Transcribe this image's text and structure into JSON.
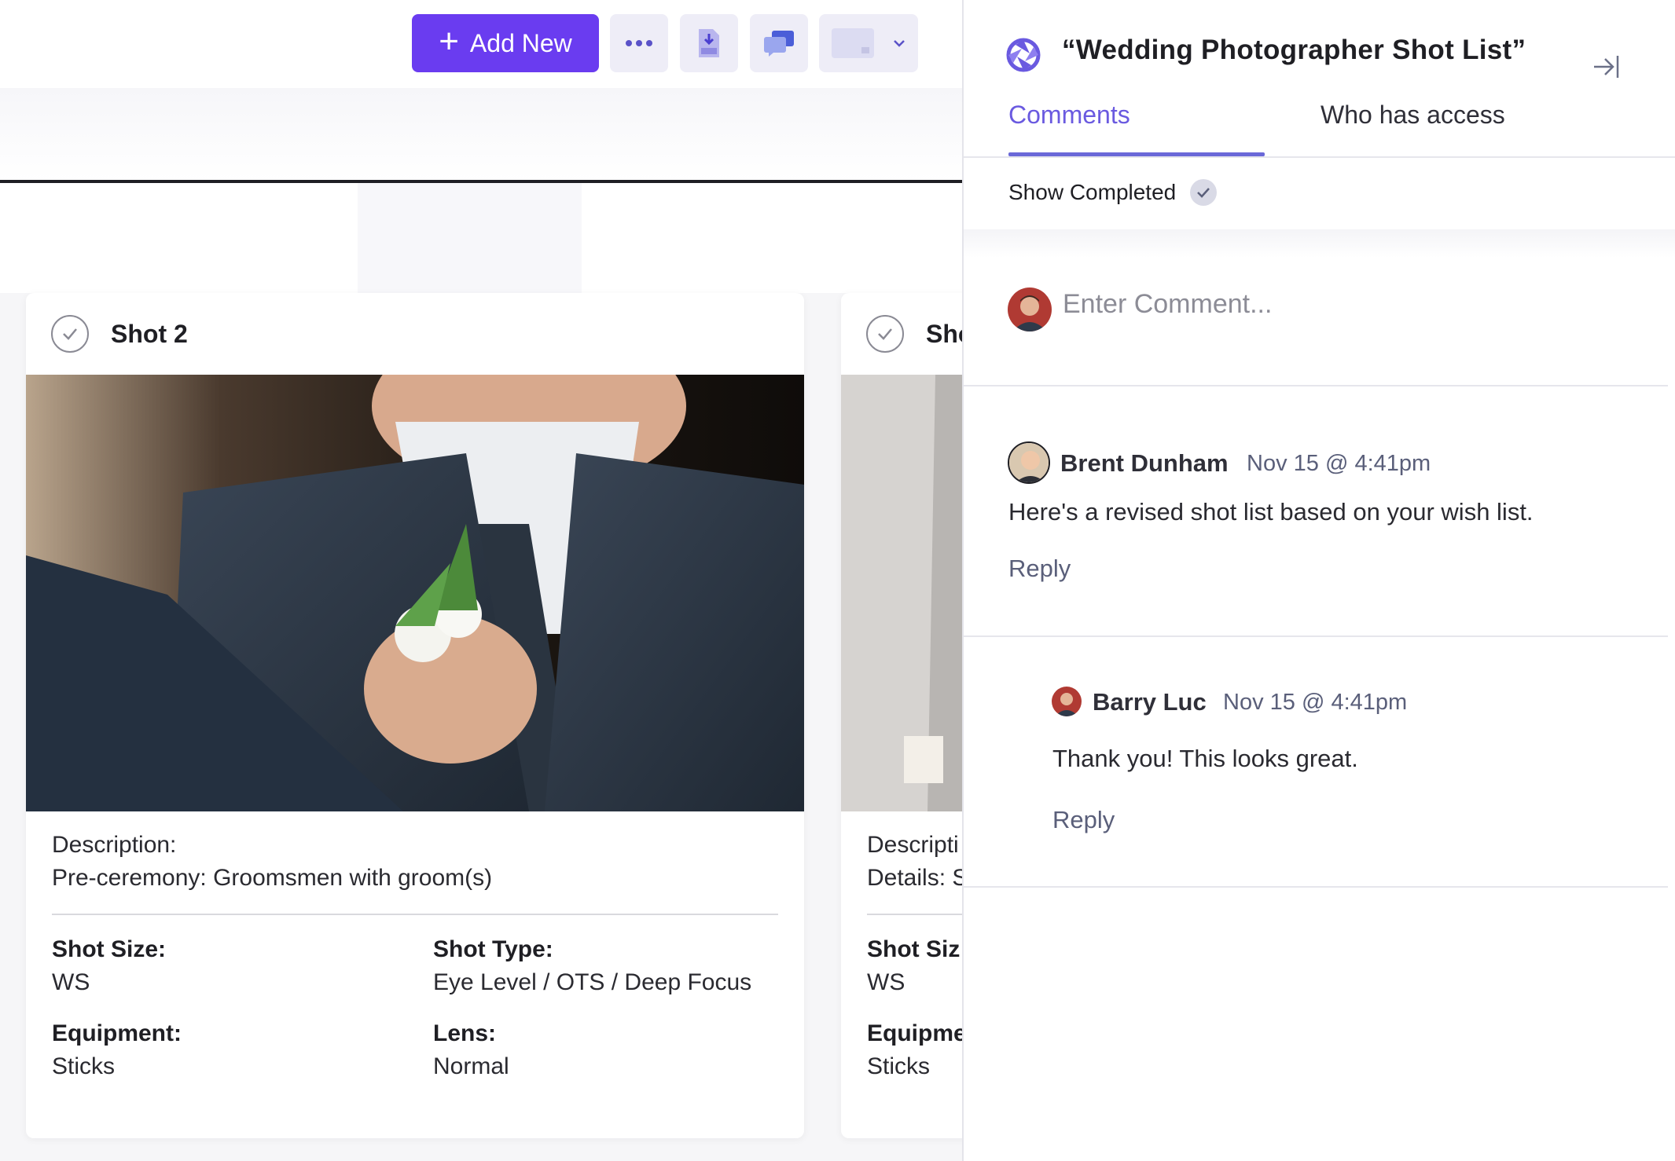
{
  "toolbar": {
    "add_new_label": "Add New",
    "more_icon": "ellipsis-icon",
    "pdf_icon": "pdf-download-icon",
    "chat_icon": "comments-icon",
    "view_icon": "view-toggle-icon",
    "accent": "#6a3cf0"
  },
  "cards": [
    {
      "title": "Shot  2",
      "description_label": "Description:",
      "description_value": "Pre-ceremony: Groomsmen with groom(s)",
      "shot_size_label": "Shot Size:",
      "shot_size_value": "WS",
      "shot_type_label": "Shot Type:",
      "shot_type_value": "Eye Level / OTS / Deep Focus",
      "equipment_label": "Equipment:",
      "equipment_value": "Sticks",
      "lens_label": "Lens:",
      "lens_value": "Normal"
    },
    {
      "title": "Sho",
      "description_label": "Descripti",
      "description_value": "Details: S",
      "shot_size_label": "Shot Siz",
      "shot_size_value": "WS",
      "equipment_label": "Equipme",
      "equipment_value": "Sticks"
    }
  ],
  "panel": {
    "title": "“Wedding Photographer Shot List”",
    "tabs": [
      {
        "label": "Comments",
        "active": true
      },
      {
        "label": "Who has access",
        "active": false
      }
    ],
    "show_completed_label": "Show Completed",
    "comment_placeholder": "Enter Comment...",
    "comments": [
      {
        "author": "Brent Dunham",
        "timestamp": "Nov 15 @ 4:41pm",
        "text": "Here's a revised shot list based on your wish list.",
        "reply_label": "Reply"
      },
      {
        "author": "Barry Luc",
        "timestamp": "Nov 15 @ 4:41pm",
        "text": "Thank you! This looks great.",
        "reply_label": "Reply"
      }
    ],
    "accent": "#6a5ae0"
  }
}
